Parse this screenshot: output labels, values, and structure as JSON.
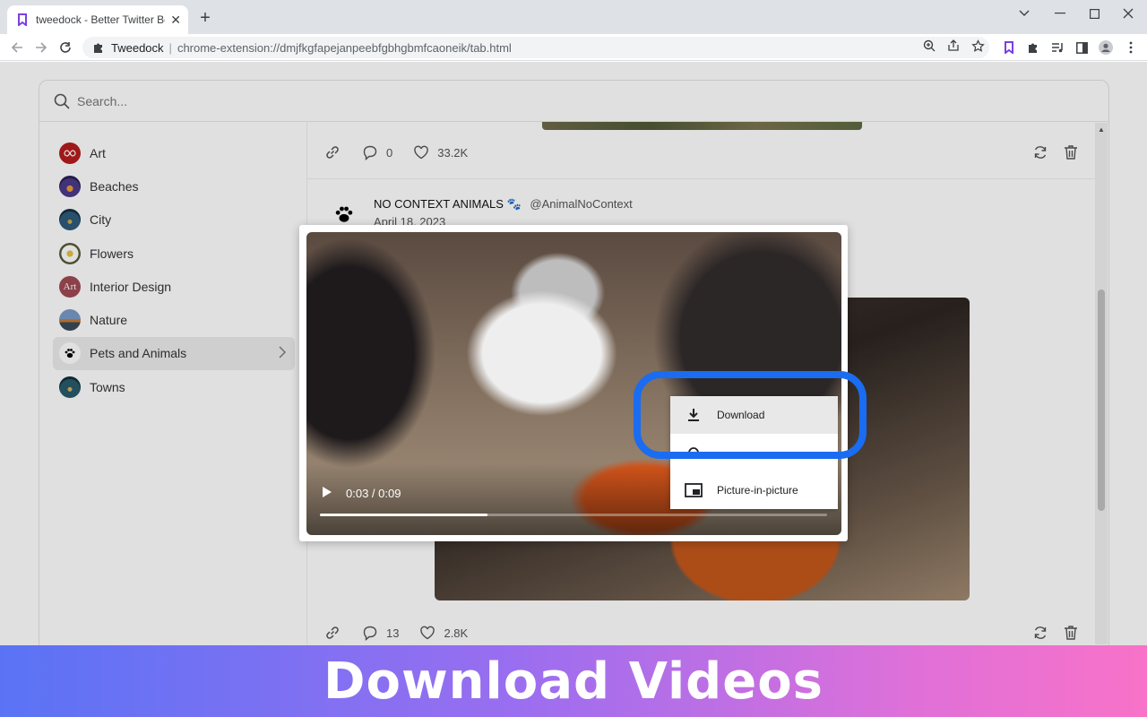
{
  "browser": {
    "tab_title": "tweedock - Better Twitter Bookm",
    "site_name": "Tweedock",
    "url": "chrome-extension://dmjfkgfapejanpeebfgbhgbmfcaoneik/tab.html"
  },
  "search": {
    "placeholder": "Search..."
  },
  "sidebar": {
    "items": [
      {
        "label": "Art",
        "icon": "art-avatar",
        "color": "#b51d1d"
      },
      {
        "label": "Beaches",
        "icon": "beaches-avatar",
        "color": "#4a3a8a"
      },
      {
        "label": "City",
        "icon": "city-avatar",
        "color": "#2e5a7a"
      },
      {
        "label": "Flowers",
        "icon": "flowers-avatar",
        "color": "#7a6a3a"
      },
      {
        "label": "Interior Design",
        "icon": "interior-design-avatar",
        "avatar_text": "Art",
        "color": "#a04a55"
      },
      {
        "label": "Nature",
        "icon": "nature-avatar",
        "color": "#5a7a9a"
      },
      {
        "label": "Pets and Animals",
        "icon": "paw-icon",
        "color": "#000000",
        "active": true
      },
      {
        "label": "Towns",
        "icon": "towns-avatar",
        "color": "#2a5a6a"
      }
    ]
  },
  "feed": {
    "tweet1": {
      "replies": "0",
      "likes": "33.2K"
    },
    "tweet2": {
      "name": "NO CONTEXT ANIMALS",
      "name_emoji": "🐾",
      "handle": "@AnimalNoContext",
      "date": "April 18, 2023",
      "replies": "13",
      "likes": "2.8K"
    }
  },
  "video": {
    "time": "0:03 / 0:09",
    "progress": 0.33
  },
  "context_menu": {
    "items": [
      {
        "label": "Download",
        "icon": "download-icon",
        "hovered": true
      },
      {
        "label": "",
        "icon": "loop-icon"
      },
      {
        "label": "Picture-in-picture",
        "icon": "picture-in-picture-icon"
      }
    ]
  },
  "banner": {
    "text": "Download Videos"
  },
  "colors": {
    "highlight": "#1a6cf0",
    "banner_start": "#5a73f5",
    "banner_end": "#f872c8"
  }
}
